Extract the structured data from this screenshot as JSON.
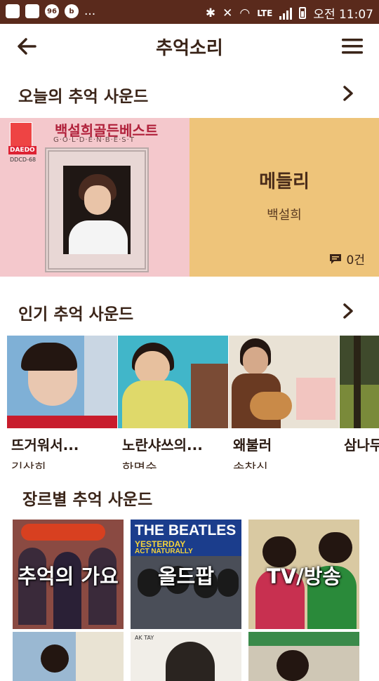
{
  "status_bar": {
    "notification_count": "96",
    "more": "...",
    "network": "LTE",
    "time": "오전 11:07"
  },
  "app": {
    "title": "추억소리"
  },
  "today": {
    "section_title": "오늘의 추억 사운드",
    "album_title": "백설희골든베스트",
    "album_subtitle": "G·O·L·D·E·N·B·E·S·T",
    "album_label": "DAEDO",
    "album_code": "DDCD-68",
    "track_title": "메들리",
    "artist": "백설희",
    "comments": "0건"
  },
  "popular": {
    "section_title": "인기 추억 사운드",
    "items": [
      {
        "title": "뜨거워서...",
        "artist": "김상희"
      },
      {
        "title": "노란샤쓰의...",
        "artist": "한명숙"
      },
      {
        "title": "왜불러",
        "artist": "송창식"
      },
      {
        "title": "삼나무",
        "artist": ""
      }
    ]
  },
  "genre": {
    "section_title": "장르별 추억 사운드",
    "items": [
      {
        "label": "추억의 가요"
      },
      {
        "label": "올드팝"
      },
      {
        "label": "TV/방송"
      }
    ]
  },
  "colors": {
    "statusbar": "#5a2a1c",
    "accent_info": "#eec47a",
    "text_dark": "#3a2418"
  }
}
